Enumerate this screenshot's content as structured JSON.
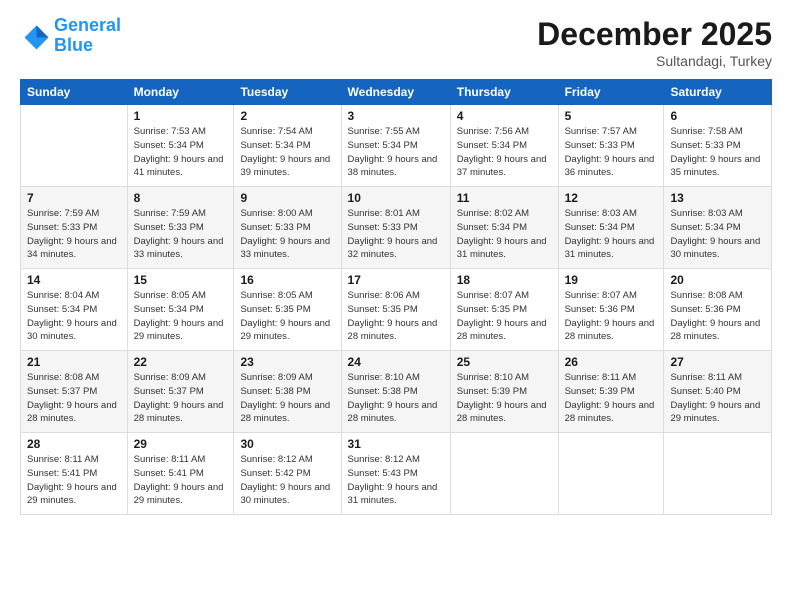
{
  "logo": {
    "line1": "General",
    "line2": "Blue"
  },
  "title": "December 2025",
  "subtitle": "Sultandagi, Turkey",
  "days_header": [
    "Sunday",
    "Monday",
    "Tuesday",
    "Wednesday",
    "Thursday",
    "Friday",
    "Saturday"
  ],
  "weeks": [
    [
      {
        "day": "",
        "sunrise": "",
        "sunset": "",
        "daylight": ""
      },
      {
        "day": "1",
        "sunrise": "Sunrise: 7:53 AM",
        "sunset": "Sunset: 5:34 PM",
        "daylight": "Daylight: 9 hours and 41 minutes."
      },
      {
        "day": "2",
        "sunrise": "Sunrise: 7:54 AM",
        "sunset": "Sunset: 5:34 PM",
        "daylight": "Daylight: 9 hours and 39 minutes."
      },
      {
        "day": "3",
        "sunrise": "Sunrise: 7:55 AM",
        "sunset": "Sunset: 5:34 PM",
        "daylight": "Daylight: 9 hours and 38 minutes."
      },
      {
        "day": "4",
        "sunrise": "Sunrise: 7:56 AM",
        "sunset": "Sunset: 5:34 PM",
        "daylight": "Daylight: 9 hours and 37 minutes."
      },
      {
        "day": "5",
        "sunrise": "Sunrise: 7:57 AM",
        "sunset": "Sunset: 5:33 PM",
        "daylight": "Daylight: 9 hours and 36 minutes."
      },
      {
        "day": "6",
        "sunrise": "Sunrise: 7:58 AM",
        "sunset": "Sunset: 5:33 PM",
        "daylight": "Daylight: 9 hours and 35 minutes."
      }
    ],
    [
      {
        "day": "7",
        "sunrise": "Sunrise: 7:59 AM",
        "sunset": "Sunset: 5:33 PM",
        "daylight": "Daylight: 9 hours and 34 minutes."
      },
      {
        "day": "8",
        "sunrise": "Sunrise: 7:59 AM",
        "sunset": "Sunset: 5:33 PM",
        "daylight": "Daylight: 9 hours and 33 minutes."
      },
      {
        "day": "9",
        "sunrise": "Sunrise: 8:00 AM",
        "sunset": "Sunset: 5:33 PM",
        "daylight": "Daylight: 9 hours and 33 minutes."
      },
      {
        "day": "10",
        "sunrise": "Sunrise: 8:01 AM",
        "sunset": "Sunset: 5:33 PM",
        "daylight": "Daylight: 9 hours and 32 minutes."
      },
      {
        "day": "11",
        "sunrise": "Sunrise: 8:02 AM",
        "sunset": "Sunset: 5:34 PM",
        "daylight": "Daylight: 9 hours and 31 minutes."
      },
      {
        "day": "12",
        "sunrise": "Sunrise: 8:03 AM",
        "sunset": "Sunset: 5:34 PM",
        "daylight": "Daylight: 9 hours and 31 minutes."
      },
      {
        "day": "13",
        "sunrise": "Sunrise: 8:03 AM",
        "sunset": "Sunset: 5:34 PM",
        "daylight": "Daylight: 9 hours and 30 minutes."
      }
    ],
    [
      {
        "day": "14",
        "sunrise": "Sunrise: 8:04 AM",
        "sunset": "Sunset: 5:34 PM",
        "daylight": "Daylight: 9 hours and 30 minutes."
      },
      {
        "day": "15",
        "sunrise": "Sunrise: 8:05 AM",
        "sunset": "Sunset: 5:34 PM",
        "daylight": "Daylight: 9 hours and 29 minutes."
      },
      {
        "day": "16",
        "sunrise": "Sunrise: 8:05 AM",
        "sunset": "Sunset: 5:35 PM",
        "daylight": "Daylight: 9 hours and 29 minutes."
      },
      {
        "day": "17",
        "sunrise": "Sunrise: 8:06 AM",
        "sunset": "Sunset: 5:35 PM",
        "daylight": "Daylight: 9 hours and 28 minutes."
      },
      {
        "day": "18",
        "sunrise": "Sunrise: 8:07 AM",
        "sunset": "Sunset: 5:35 PM",
        "daylight": "Daylight: 9 hours and 28 minutes."
      },
      {
        "day": "19",
        "sunrise": "Sunrise: 8:07 AM",
        "sunset": "Sunset: 5:36 PM",
        "daylight": "Daylight: 9 hours and 28 minutes."
      },
      {
        "day": "20",
        "sunrise": "Sunrise: 8:08 AM",
        "sunset": "Sunset: 5:36 PM",
        "daylight": "Daylight: 9 hours and 28 minutes."
      }
    ],
    [
      {
        "day": "21",
        "sunrise": "Sunrise: 8:08 AM",
        "sunset": "Sunset: 5:37 PM",
        "daylight": "Daylight: 9 hours and 28 minutes."
      },
      {
        "day": "22",
        "sunrise": "Sunrise: 8:09 AM",
        "sunset": "Sunset: 5:37 PM",
        "daylight": "Daylight: 9 hours and 28 minutes."
      },
      {
        "day": "23",
        "sunrise": "Sunrise: 8:09 AM",
        "sunset": "Sunset: 5:38 PM",
        "daylight": "Daylight: 9 hours and 28 minutes."
      },
      {
        "day": "24",
        "sunrise": "Sunrise: 8:10 AM",
        "sunset": "Sunset: 5:38 PM",
        "daylight": "Daylight: 9 hours and 28 minutes."
      },
      {
        "day": "25",
        "sunrise": "Sunrise: 8:10 AM",
        "sunset": "Sunset: 5:39 PM",
        "daylight": "Daylight: 9 hours and 28 minutes."
      },
      {
        "day": "26",
        "sunrise": "Sunrise: 8:11 AM",
        "sunset": "Sunset: 5:39 PM",
        "daylight": "Daylight: 9 hours and 28 minutes."
      },
      {
        "day": "27",
        "sunrise": "Sunrise: 8:11 AM",
        "sunset": "Sunset: 5:40 PM",
        "daylight": "Daylight: 9 hours and 29 minutes."
      }
    ],
    [
      {
        "day": "28",
        "sunrise": "Sunrise: 8:11 AM",
        "sunset": "Sunset: 5:41 PM",
        "daylight": "Daylight: 9 hours and 29 minutes."
      },
      {
        "day": "29",
        "sunrise": "Sunrise: 8:11 AM",
        "sunset": "Sunset: 5:41 PM",
        "daylight": "Daylight: 9 hours and 29 minutes."
      },
      {
        "day": "30",
        "sunrise": "Sunrise: 8:12 AM",
        "sunset": "Sunset: 5:42 PM",
        "daylight": "Daylight: 9 hours and 30 minutes."
      },
      {
        "day": "31",
        "sunrise": "Sunrise: 8:12 AM",
        "sunset": "Sunset: 5:43 PM",
        "daylight": "Daylight: 9 hours and 31 minutes."
      },
      {
        "day": "",
        "sunrise": "",
        "sunset": "",
        "daylight": ""
      },
      {
        "day": "",
        "sunrise": "",
        "sunset": "",
        "daylight": ""
      },
      {
        "day": "",
        "sunrise": "",
        "sunset": "",
        "daylight": ""
      }
    ]
  ]
}
